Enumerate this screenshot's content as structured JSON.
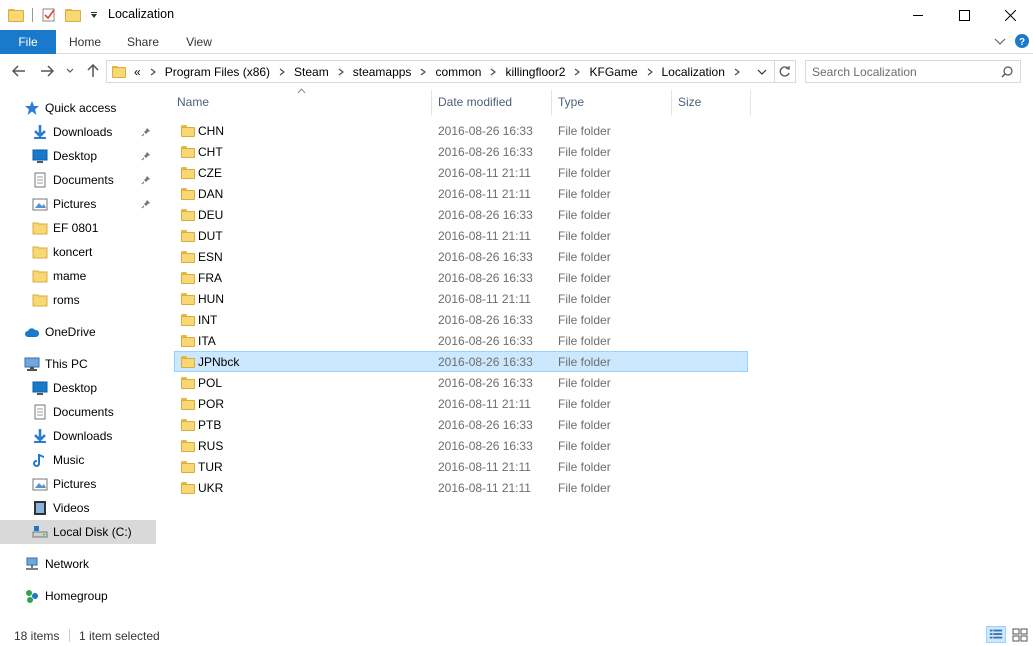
{
  "window": {
    "title": "Localization",
    "controls": [
      "minimize",
      "maximize",
      "close"
    ]
  },
  "ribbon": {
    "tabs": [
      "File",
      "Home",
      "Share",
      "View"
    ]
  },
  "address": {
    "overflow": "«",
    "crumbs": [
      "Program Files (x86)",
      "Steam",
      "steamapps",
      "common",
      "killingfloor2",
      "KFGame",
      "Localization"
    ]
  },
  "search": {
    "placeholder": "Search Localization"
  },
  "sidebar": {
    "items": [
      {
        "label": "Quick access",
        "icon": "star-icon",
        "indent": 0,
        "pinned": false
      },
      {
        "label": "Downloads",
        "icon": "download-arrow-icon",
        "indent": 1,
        "pinned": true
      },
      {
        "label": "Desktop",
        "icon": "desktop-icon",
        "indent": 1,
        "pinned": true
      },
      {
        "label": "Documents",
        "icon": "document-icon",
        "indent": 1,
        "pinned": true
      },
      {
        "label": "Pictures",
        "icon": "pictures-icon",
        "indent": 1,
        "pinned": true
      },
      {
        "label": "EF 0801",
        "icon": "folder-icon",
        "indent": 1,
        "pinned": false
      },
      {
        "label": "koncert",
        "icon": "folder-icon",
        "indent": 1,
        "pinned": false
      },
      {
        "label": "mame",
        "icon": "folder-icon",
        "indent": 1,
        "pinned": false
      },
      {
        "label": "roms",
        "icon": "folder-icon",
        "indent": 1,
        "pinned": false
      },
      {
        "label": "OneDrive",
        "icon": "cloud-icon",
        "indent": 0,
        "pinned": false
      },
      {
        "label": "This PC",
        "icon": "computer-icon",
        "indent": 0,
        "pinned": false
      },
      {
        "label": "Desktop",
        "icon": "desktop-icon",
        "indent": 1,
        "pinned": false
      },
      {
        "label": "Documents",
        "icon": "document-icon",
        "indent": 1,
        "pinned": false
      },
      {
        "label": "Downloads",
        "icon": "download-arrow-icon",
        "indent": 1,
        "pinned": false
      },
      {
        "label": "Music",
        "icon": "music-note-icon",
        "indent": 1,
        "pinned": false
      },
      {
        "label": "Pictures",
        "icon": "pictures-icon",
        "indent": 1,
        "pinned": false
      },
      {
        "label": "Videos",
        "icon": "film-icon",
        "indent": 1,
        "pinned": false
      },
      {
        "label": "Local Disk (C:)",
        "icon": "drive-icon",
        "indent": 1,
        "pinned": false,
        "selected": true
      },
      {
        "label": "Network",
        "icon": "network-icon",
        "indent": 0,
        "pinned": false
      },
      {
        "label": "Homegroup",
        "icon": "homegroup-icon",
        "indent": 0,
        "pinned": false
      }
    ]
  },
  "columns": {
    "name": "Name",
    "date": "Date modified",
    "type": "Type",
    "size": "Size"
  },
  "files": [
    {
      "name": "CHN",
      "date": "2016-08-26 16:33",
      "type": "File folder"
    },
    {
      "name": "CHT",
      "date": "2016-08-26 16:33",
      "type": "File folder"
    },
    {
      "name": "CZE",
      "date": "2016-08-11 21:11",
      "type": "File folder"
    },
    {
      "name": "DAN",
      "date": "2016-08-11 21:11",
      "type": "File folder"
    },
    {
      "name": "DEU",
      "date": "2016-08-26 16:33",
      "type": "File folder"
    },
    {
      "name": "DUT",
      "date": "2016-08-11 21:11",
      "type": "File folder"
    },
    {
      "name": "ESN",
      "date": "2016-08-26 16:33",
      "type": "File folder"
    },
    {
      "name": "FRA",
      "date": "2016-08-26 16:33",
      "type": "File folder"
    },
    {
      "name": "HUN",
      "date": "2016-08-11 21:11",
      "type": "File folder"
    },
    {
      "name": "INT",
      "date": "2016-08-26 16:33",
      "type": "File folder"
    },
    {
      "name": "ITA",
      "date": "2016-08-26 16:33",
      "type": "File folder"
    },
    {
      "name": "JPNbck",
      "date": "2016-08-26 16:33",
      "type": "File folder",
      "selected": true
    },
    {
      "name": "POL",
      "date": "2016-08-26 16:33",
      "type": "File folder"
    },
    {
      "name": "POR",
      "date": "2016-08-11 21:11",
      "type": "File folder"
    },
    {
      "name": "PTB",
      "date": "2016-08-26 16:33",
      "type": "File folder"
    },
    {
      "name": "RUS",
      "date": "2016-08-26 16:33",
      "type": "File folder"
    },
    {
      "name": "TUR",
      "date": "2016-08-11 21:11",
      "type": "File folder"
    },
    {
      "name": "UKR",
      "date": "2016-08-11 21:11",
      "type": "File folder"
    }
  ],
  "status": {
    "item_count": "18 items",
    "selection": "1 item selected"
  },
  "colors": {
    "accent": "#1979ca",
    "selection_bg": "#cce8ff",
    "selection_border": "#99d1ff",
    "folder_yellow": "#f8d775"
  }
}
